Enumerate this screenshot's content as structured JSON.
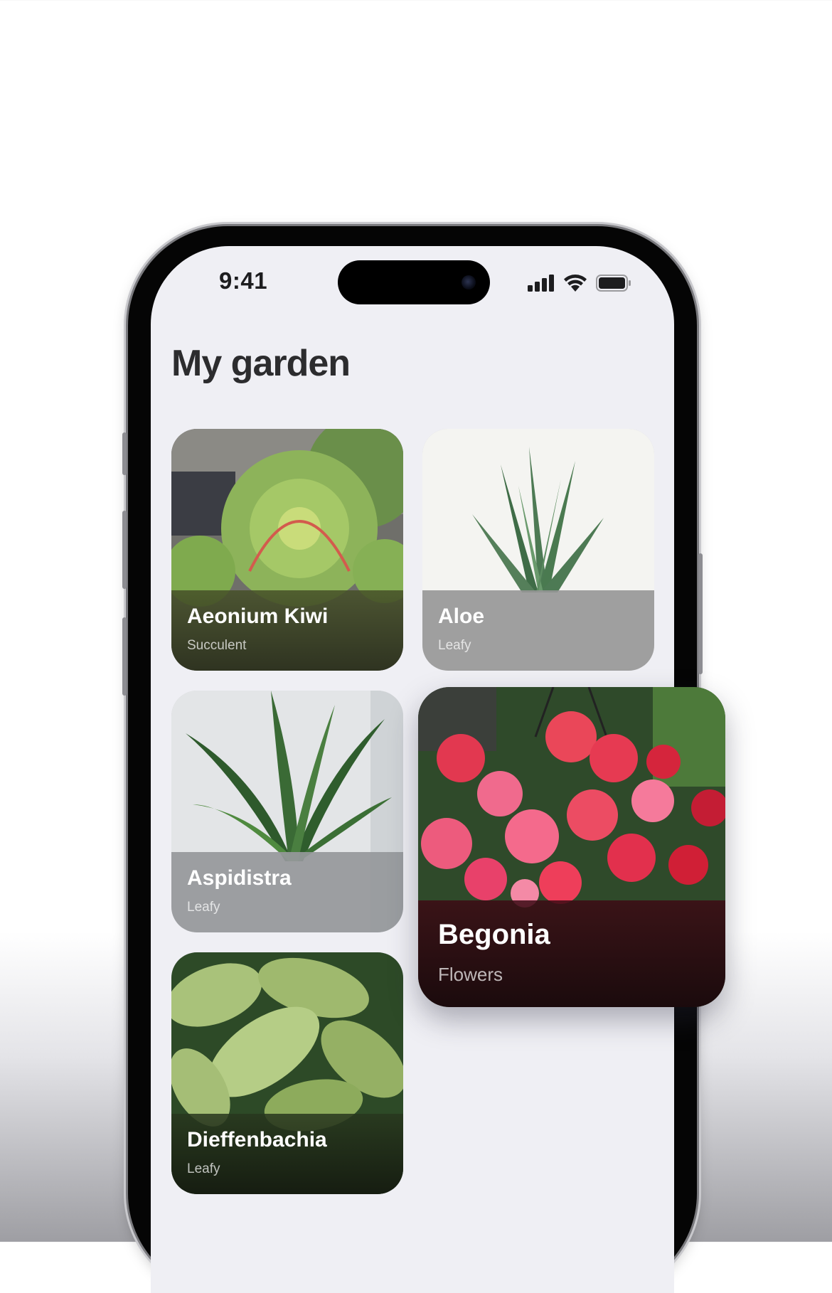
{
  "status_bar": {
    "time": "9:41",
    "icons": [
      "signal-icon",
      "wifi-icon",
      "battery-icon"
    ]
  },
  "screen": {
    "title": "My garden"
  },
  "plants": [
    {
      "name": "Aeonium Kiwi",
      "category": "Succulent"
    },
    {
      "name": "Aloe",
      "category": "Leafy"
    },
    {
      "name": "Aspidistra",
      "category": "Leafy"
    },
    {
      "name": "Dieffenbachia",
      "category": "Leafy"
    }
  ],
  "dragged_card": {
    "name": "Begonia",
    "category": "Flowers"
  },
  "colors": {
    "screen_bg": "#efeff4",
    "title": "#2c2c2e",
    "card_text": "#ffffff"
  }
}
